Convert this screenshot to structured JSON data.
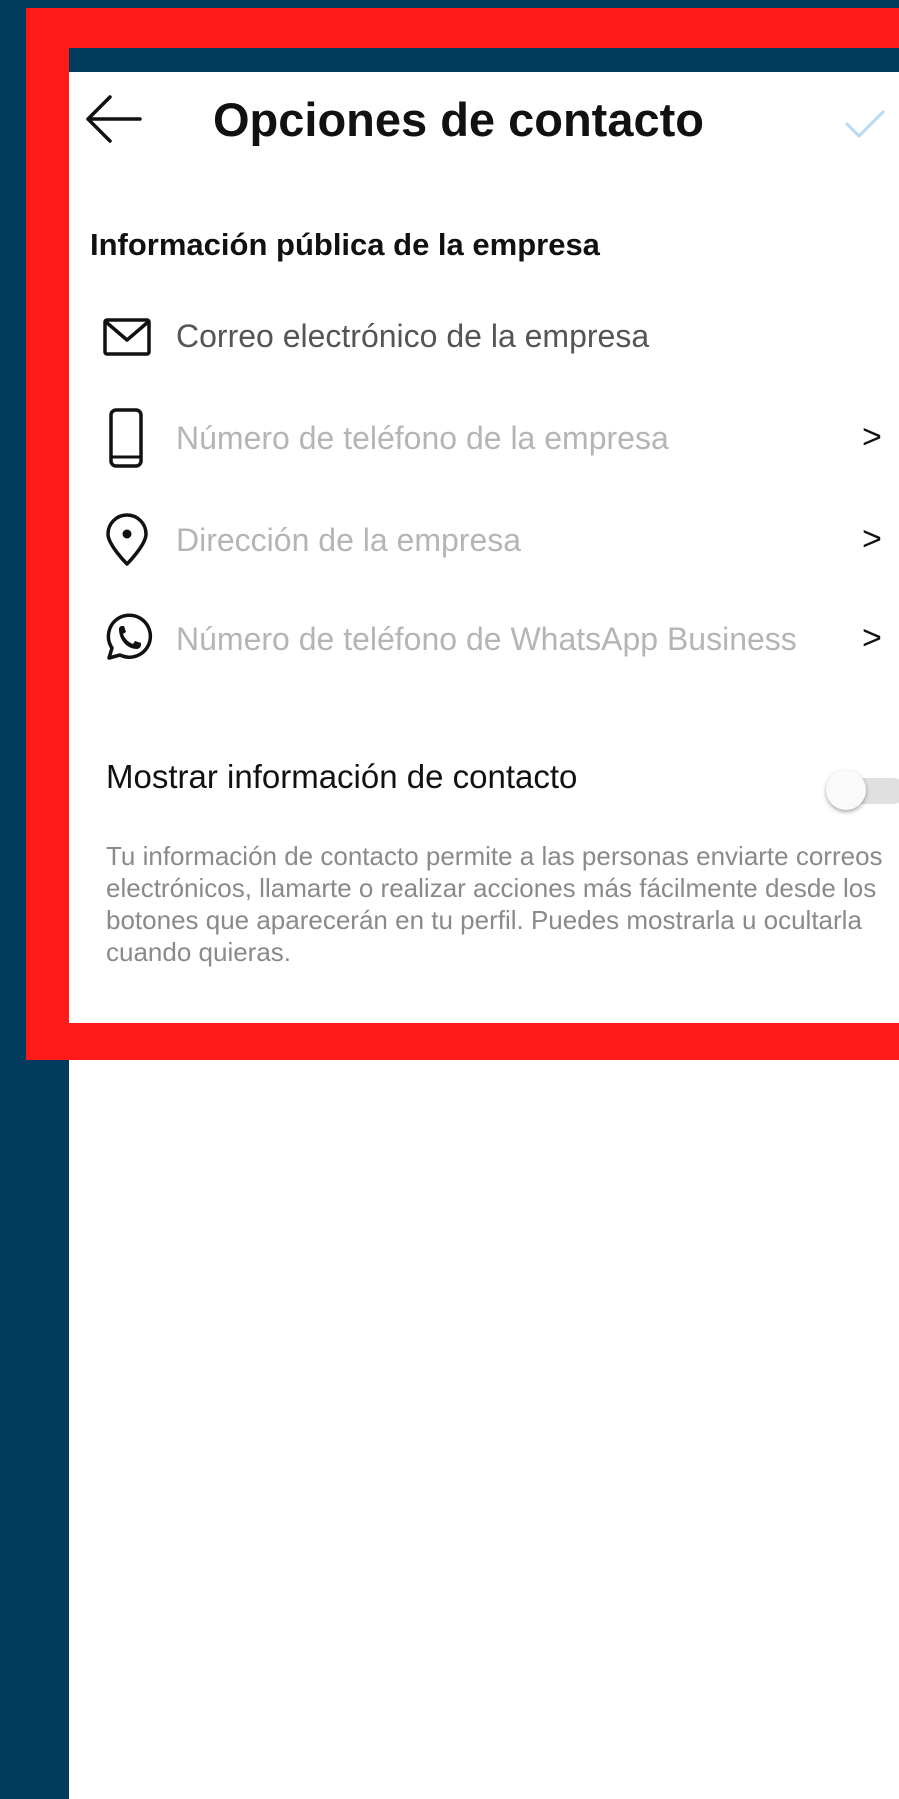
{
  "header": {
    "title": "Opciones de contacto"
  },
  "section": {
    "heading": "Información pública de la empresa"
  },
  "contact_rows": [
    {
      "icon": "mail-icon",
      "label": "Correo electrónico de la empresa",
      "has_chevron": false
    },
    {
      "icon": "phone-icon",
      "label": "Número de teléfono de la empresa",
      "has_chevron": true
    },
    {
      "icon": "location-pin-icon",
      "label": "Dirección de la empresa",
      "has_chevron": true
    },
    {
      "icon": "whatsapp-icon",
      "label": "Número de teléfono de WhatsApp Business",
      "has_chevron": true
    }
  ],
  "chevron": ">",
  "display_toggle": {
    "label": "Mostrar información de contacto",
    "enabled": false
  },
  "description": "Tu información de contacto permite a las personas enviarte correos electrónicos, llamarte o realizar acciones más fácilmente desde los botones que aparecerán en tu perfil. Puedes mostrarla u ocultarla cuando quieras.",
  "colors": {
    "highlight": "#ff1a1a",
    "background": "#003a5c",
    "label_primary": "#555555",
    "label_placeholder": "#b5b5b5",
    "done_check": "#b9d9f2"
  }
}
